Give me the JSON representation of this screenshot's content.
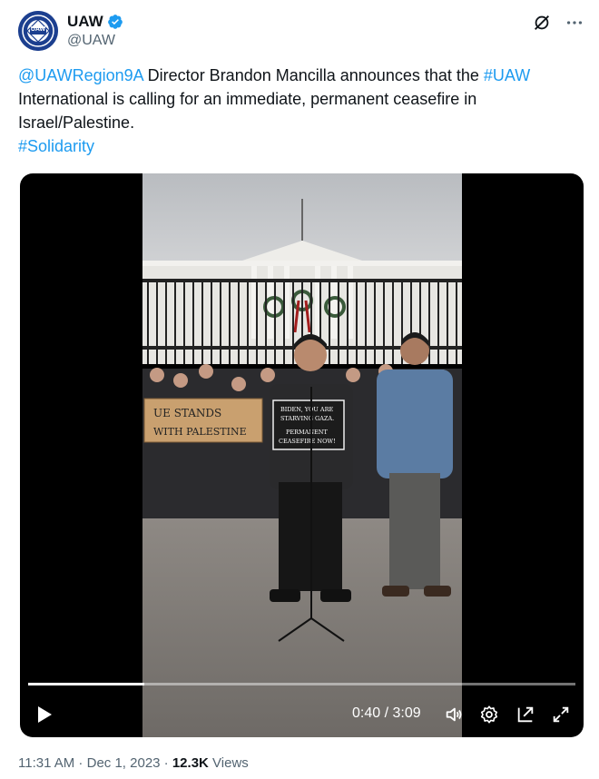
{
  "account": {
    "display_name": "UAW",
    "handle": "@UAW",
    "verified": true,
    "avatar_text": "UAW"
  },
  "tweet": {
    "mention": "@UAWRegion9A",
    "text_1": " Director Brandon Mancilla announces that the ",
    "hashtag_1": "#UAW",
    "text_2": " International is calling for an immediate, permanent ceasefire in Israel/Palestine.",
    "hashtag_2": "#Solidarity"
  },
  "video": {
    "current_time": "0:40",
    "duration": "3:09",
    "time_display": "0:40 / 3:09",
    "progress": 0.212,
    "sign_left_line1": "UE STANDS",
    "sign_left_line2": "WITH PALESTINE",
    "sign_center_line1": "BIDEN, YOU ARE",
    "sign_center_line2": "STARVING GAZA.",
    "sign_center_line3": "PERMANENT",
    "sign_center_line4": "CEASEFIRE NOW!"
  },
  "meta": {
    "time": "11:31 AM",
    "date": "Dec 1, 2023",
    "separator": " · ",
    "views_count": "12.3K",
    "views_label": "Views"
  },
  "colors": {
    "link": "#1d9bf0",
    "verified": "#1d9bf0",
    "muted": "#536471",
    "avatar_bg": "#1c3f8f"
  }
}
